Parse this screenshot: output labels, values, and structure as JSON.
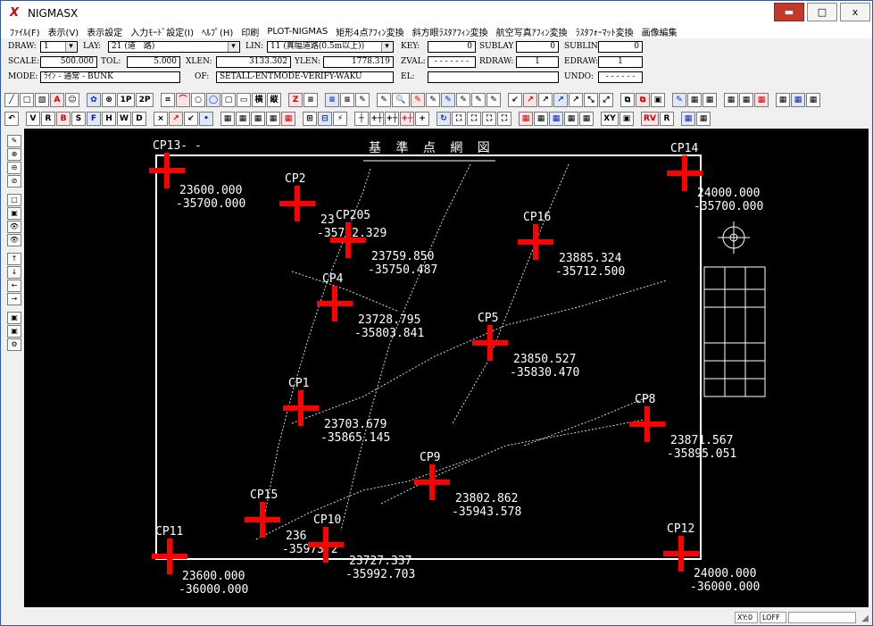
{
  "window": {
    "title": "NIGMASX",
    "app_icon": "X",
    "minimize_glyph": "▬",
    "maximize_glyph": "□",
    "close_glyph": "x"
  },
  "menu": [
    "ﾌｧｲﾙ(F)",
    "表示(V)",
    "表示設定",
    "入力ﾓｰﾄﾞ設定(I)",
    "ﾍﾙﾌﾟ(H)",
    "印刷",
    "PLOT-NIGMAS",
    "矩形4点ｱﾌｨﾝ変換",
    "斜方眼ﾗｽﾀｱﾌｨﾝ変換",
    "航空写真ｱﾌｨﾝ変換",
    "ﾗｽﾀﾌｫｰﾏｯﾄ変換",
    "画像編集"
  ],
  "info": {
    "draw_label": "DRAW:",
    "draw_value": "1",
    "lay_label": "LAY:",
    "lay_value": "21 (道　路)",
    "lin_label": "LIN:",
    "lin_value": "11 (真幅道路(0.5m以上))",
    "key_label": "KEY:",
    "key_value": "0",
    "sublay_label": "SUBLAY",
    "sublay_value": "0",
    "sublin_label": "SUBLIN:",
    "sublin_value": "0",
    "scale_label": "SCALE:",
    "scale_value": "500.000",
    "tol_label": "TOL:",
    "tol_value": "5.000",
    "xlen_label": "XLEN:",
    "xlen_value": "3133.302",
    "ylen_label": "YLEN:",
    "ylen_value": "1778.319",
    "zval_label": "ZVAL:",
    "zval_value": "- - - - - - -",
    "rdraw_label": "RDRAW:",
    "rdraw_value": "1",
    "edraw_label": "EDRAW:",
    "edraw_value": "1",
    "mode_label": "MODE:",
    "mode_value": "ﾗｲﾝ - 通常 - BUNK",
    "of_label": "OF:",
    "of_value": "SETALL-ENTMODE-VERIFY-WAKU",
    "el_label": "EL:",
    "el_value": "",
    "undo_label": "UNDO:",
    "undo_value": "- - - - - -"
  },
  "toolbar1": [
    "╱",
    "□",
    "▧",
    "A",
    "☺",
    "✿",
    "⊗",
    "1P",
    "2P",
    "⌗",
    "⌒",
    "○",
    "◯",
    "▢",
    "▭",
    "横",
    "縦",
    "Z",
    "≡",
    "≡",
    "≡",
    "✎",
    "✎",
    "🔍",
    "✎",
    "✎",
    "✎",
    "✎",
    "✎",
    "✎",
    "↙",
    "↗",
    "↗",
    "↗",
    "↗",
    "⤡",
    "⤢",
    "⧉",
    "⧉",
    "▣",
    "✎",
    "▦",
    "▦",
    "▦",
    "▦",
    "▦",
    "▦",
    "▦",
    "▦"
  ],
  "toolbar2": [
    "↶",
    "V",
    "R",
    "B",
    "S",
    "F",
    "H",
    "W",
    "D",
    "×",
    "↗",
    "↙",
    "•",
    "▦",
    "▦",
    "▦",
    "▦",
    "▦",
    "⊞",
    "⊟",
    "⚡",
    "┼",
    "+┼",
    "+┼",
    "+┼",
    "+",
    "↻",
    "⛶",
    "⛶",
    "⛶",
    "⛶",
    "▦",
    "▦",
    "▦",
    "▦",
    "▦",
    "XY",
    "▣",
    "RV",
    "R",
    "▦",
    "▦"
  ],
  "lefttools": [
    "✎",
    "⊕",
    "⊖",
    "⊘",
    "□",
    "▣",
    "👁",
    "👁",
    "↑",
    "↓",
    "←",
    "→",
    "▣",
    "▣",
    "⚙"
  ],
  "drawing": {
    "sheet_title": "基 準 点 網 図",
    "points": [
      {
        "id": "CP13",
        "label": "CP13- -",
        "x_coord": "23600.000",
        "y_coord": "-35700.000"
      },
      {
        "id": "CP2",
        "label": "CP2",
        "x_coord": "23",
        "y_coord": "-35722.329"
      },
      {
        "id": "CP205",
        "label": "CP205",
        "x_coord": "23759.850",
        "y_coord": "-35750.487"
      },
      {
        "id": "CP16",
        "label": "CP16",
        "x_coord": "23885.324",
        "y_coord": "-35712.500"
      },
      {
        "id": "CP14",
        "label": "CP14",
        "x_coord": "24000.000",
        "y_coord": "-35700.000"
      },
      {
        "id": "CP4",
        "label": "CP4",
        "x_coord": "23728.795",
        "y_coord": "-35803.841"
      },
      {
        "id": "CP5",
        "label": "CP5",
        "x_coord": "23850.527",
        "y_coord": "-35830.470"
      },
      {
        "id": "CP1",
        "label": "CP1",
        "x_coord": "23703.679",
        "y_coord": "-35865.145"
      },
      {
        "id": "CP8",
        "label": "CP8",
        "x_coord": "23871.567",
        "y_coord": "-35895.051"
      },
      {
        "id": "CP9",
        "label": "CP9",
        "x_coord": "23802.862",
        "y_coord": "-35943.578"
      },
      {
        "id": "CP15",
        "label": "CP15",
        "x_coord": "236",
        "y_coord": "-35973.2"
      },
      {
        "id": "CP10",
        "label": "CP10",
        "x_coord": "23727.337",
        "y_coord": "-35992.703"
      },
      {
        "id": "CP11",
        "label": "CP11",
        "x_coord": "23600.000",
        "y_coord": "-36000.000"
      },
      {
        "id": "CP12",
        "label": "CP12",
        "x_coord": "24000.000",
        "y_coord": "-36000.000"
      }
    ],
    "marker_color": "#ff0000"
  },
  "status": {
    "xy": "XY:0",
    "loff": "LOFF",
    "blank": ""
  }
}
